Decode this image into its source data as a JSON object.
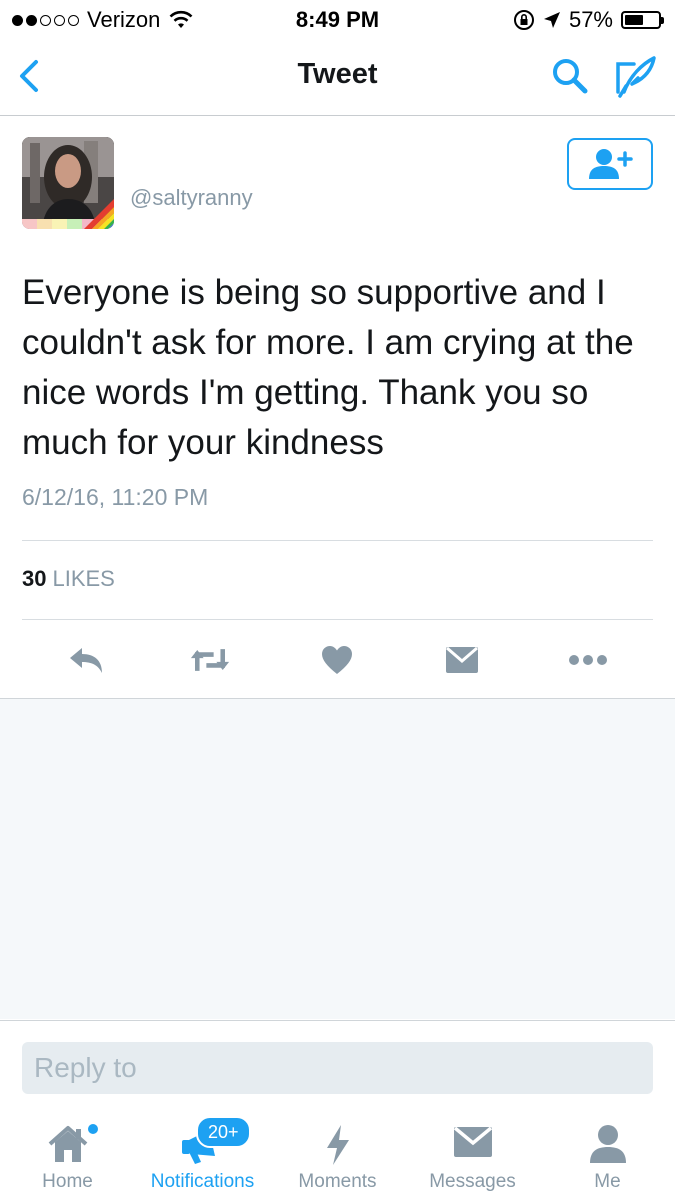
{
  "status_bar": {
    "carrier": "Verizon",
    "time": "8:49 PM",
    "battery": "57%",
    "battery_level": 0.57,
    "icons": [
      "signal-dots-icon",
      "wifi-icon",
      "rotation-lock-icon",
      "location-arrow-icon",
      "battery-icon"
    ]
  },
  "nav": {
    "title": "Tweet",
    "icons": [
      "back-chevron-icon",
      "search-icon",
      "compose-icon"
    ]
  },
  "tweet": {
    "handle": "@saltyranny",
    "text": "Everyone is being so supportive and I couldn't ask for more. I am crying at the nice words I'm getting. Thank you so much for your kindness",
    "timestamp": "6/12/16, 11:20 PM",
    "likes_count": "30",
    "likes_label": "LIKES",
    "actions": [
      "reply-icon",
      "retweet-icon",
      "like-icon",
      "direct-message-icon",
      "more-icon"
    ]
  },
  "reply": {
    "placeholder": "Reply to"
  },
  "tabs": {
    "items": [
      {
        "label": "Home",
        "icon": "home-icon"
      },
      {
        "label": "Notifications",
        "icon": "notifications-icon",
        "active": true
      },
      {
        "label": "Moments",
        "icon": "moments-icon"
      },
      {
        "label": "Messages",
        "icon": "messages-icon"
      },
      {
        "label": "Me",
        "icon": "me-icon"
      }
    ],
    "notifications_badge": "20+"
  },
  "colors": {
    "accent": "#1da1f2",
    "text": "#14171a",
    "secondary_text": "#8899a6",
    "background_gray": "#f5f8fa"
  }
}
